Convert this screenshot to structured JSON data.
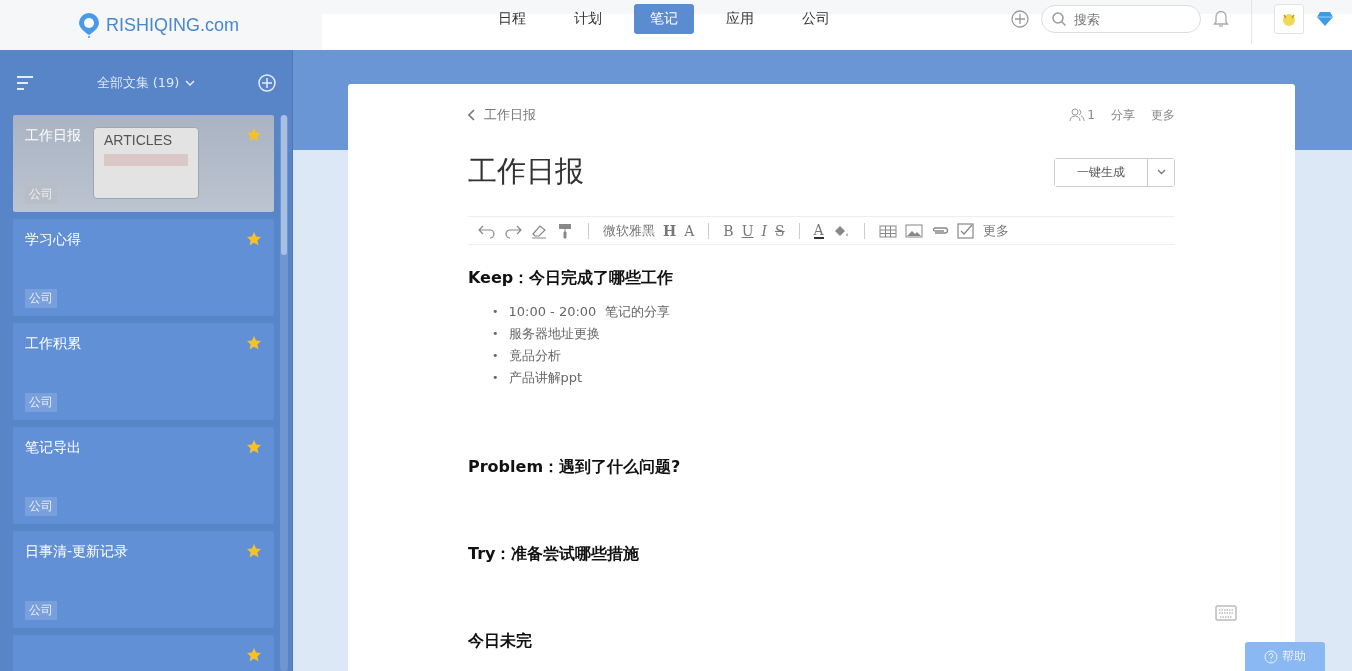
{
  "header": {
    "logo": "RISHIQING.com",
    "nav": [
      {
        "label": "日程",
        "selected": false
      },
      {
        "label": "计划",
        "selected": false
      },
      {
        "label": "笔记",
        "selected": true
      },
      {
        "label": "应用",
        "selected": false
      },
      {
        "label": "公司",
        "selected": false
      }
    ],
    "search": {
      "placeholder": "搜索"
    }
  },
  "sidebar": {
    "collection": "全部文集 (19)",
    "notes": [
      {
        "title": "工作日报",
        "tag": "公司",
        "starred": true,
        "selected": true,
        "cover": "ARTICLES"
      },
      {
        "title": "学习心得",
        "tag": "公司",
        "starred": true,
        "selected": false
      },
      {
        "title": "工作积累",
        "tag": "公司",
        "starred": true,
        "selected": false
      },
      {
        "title": "笔记导出",
        "tag": "公司",
        "starred": true,
        "selected": false
      },
      {
        "title": "日事清-更新记录",
        "tag": "公司",
        "starred": true,
        "selected": false
      },
      {
        "starred": true,
        "selected": false
      }
    ]
  },
  "document": {
    "breadcrumb": "工作日报",
    "members": "1",
    "share": "分享",
    "more": "更多",
    "title": "工作日报",
    "generate_button": "一键生成",
    "toolbar": {
      "font": "微软雅黑",
      "heading": "H",
      "size": "A",
      "bold": "B",
      "underline": "U",
      "italic": "I",
      "strike": "S",
      "text_color": "A",
      "more": "更多"
    },
    "sections": [
      {
        "heading": "Keep：今日完成了哪些工作",
        "items": [
          {
            "marker": "•",
            "text": "10:00 - 20:00  笔记的分享"
          },
          {
            "marker": "•",
            "text": "服务器地址更换"
          },
          {
            "marker": "•",
            "text": "竟品分析"
          },
          {
            "marker": "•",
            "text": "产品讲解ppt"
          }
        ]
      },
      {
        "heading": "Problem：遇到了什么问题?"
      },
      {
        "heading": "Try：准备尝试哪些措施"
      },
      {
        "heading": "今日未完"
      }
    ]
  },
  "help_button": "帮助"
}
